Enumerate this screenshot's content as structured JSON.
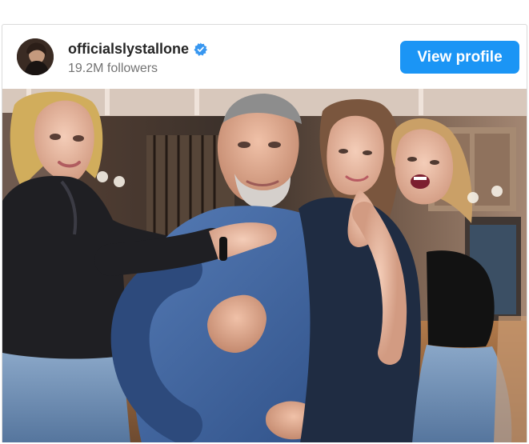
{
  "post_header": {
    "username": "officialslystallone",
    "followers": "19.2M followers",
    "view_profile_label": "View profile"
  },
  "icons": {
    "verified": "verified-badge-icon",
    "avatar": "profile-avatar"
  },
  "colors": {
    "primary_button": "#1b95f5",
    "verified_badge": "#3897f0",
    "username_text": "#262626",
    "secondary_text": "#737373",
    "card_border": "#dbdbdb"
  }
}
